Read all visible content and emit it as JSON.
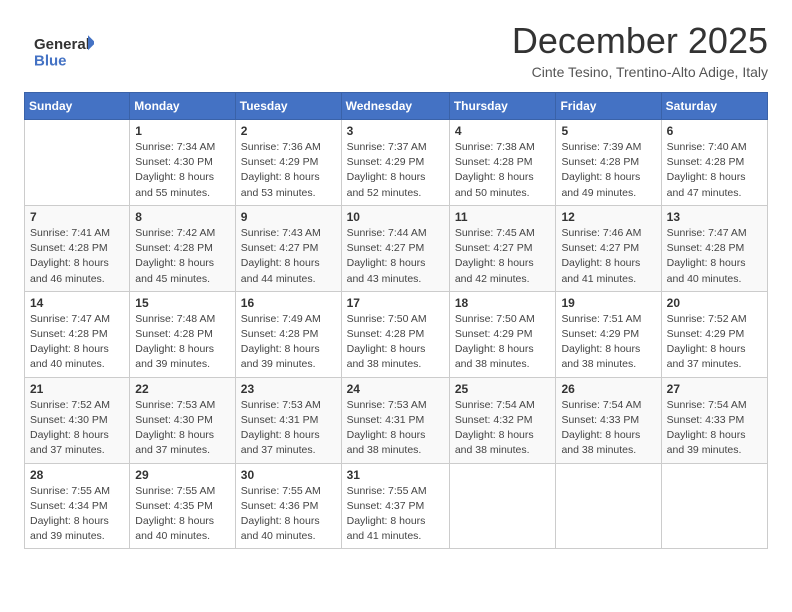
{
  "logo": {
    "line1": "General",
    "line2": "Blue"
  },
  "title": "December 2025",
  "subtitle": "Cinte Tesino, Trentino-Alto Adige, Italy",
  "weekdays": [
    "Sunday",
    "Monday",
    "Tuesday",
    "Wednesday",
    "Thursday",
    "Friday",
    "Saturday"
  ],
  "weeks": [
    [
      null,
      {
        "day": 1,
        "sunrise": "7:34 AM",
        "sunset": "4:30 PM",
        "daylight": "8 hours and 55 minutes."
      },
      {
        "day": 2,
        "sunrise": "7:36 AM",
        "sunset": "4:29 PM",
        "daylight": "8 hours and 53 minutes."
      },
      {
        "day": 3,
        "sunrise": "7:37 AM",
        "sunset": "4:29 PM",
        "daylight": "8 hours and 52 minutes."
      },
      {
        "day": 4,
        "sunrise": "7:38 AM",
        "sunset": "4:28 PM",
        "daylight": "8 hours and 50 minutes."
      },
      {
        "day": 5,
        "sunrise": "7:39 AM",
        "sunset": "4:28 PM",
        "daylight": "8 hours and 49 minutes."
      },
      {
        "day": 6,
        "sunrise": "7:40 AM",
        "sunset": "4:28 PM",
        "daylight": "8 hours and 47 minutes."
      }
    ],
    [
      {
        "day": 7,
        "sunrise": "7:41 AM",
        "sunset": "4:28 PM",
        "daylight": "8 hours and 46 minutes."
      },
      {
        "day": 8,
        "sunrise": "7:42 AM",
        "sunset": "4:28 PM",
        "daylight": "8 hours and 45 minutes."
      },
      {
        "day": 9,
        "sunrise": "7:43 AM",
        "sunset": "4:27 PM",
        "daylight": "8 hours and 44 minutes."
      },
      {
        "day": 10,
        "sunrise": "7:44 AM",
        "sunset": "4:27 PM",
        "daylight": "8 hours and 43 minutes."
      },
      {
        "day": 11,
        "sunrise": "7:45 AM",
        "sunset": "4:27 PM",
        "daylight": "8 hours and 42 minutes."
      },
      {
        "day": 12,
        "sunrise": "7:46 AM",
        "sunset": "4:27 PM",
        "daylight": "8 hours and 41 minutes."
      },
      {
        "day": 13,
        "sunrise": "7:47 AM",
        "sunset": "4:28 PM",
        "daylight": "8 hours and 40 minutes."
      }
    ],
    [
      {
        "day": 14,
        "sunrise": "7:47 AM",
        "sunset": "4:28 PM",
        "daylight": "8 hours and 40 minutes."
      },
      {
        "day": 15,
        "sunrise": "7:48 AM",
        "sunset": "4:28 PM",
        "daylight": "8 hours and 39 minutes."
      },
      {
        "day": 16,
        "sunrise": "7:49 AM",
        "sunset": "4:28 PM",
        "daylight": "8 hours and 39 minutes."
      },
      {
        "day": 17,
        "sunrise": "7:50 AM",
        "sunset": "4:28 PM",
        "daylight": "8 hours and 38 minutes."
      },
      {
        "day": 18,
        "sunrise": "7:50 AM",
        "sunset": "4:29 PM",
        "daylight": "8 hours and 38 minutes."
      },
      {
        "day": 19,
        "sunrise": "7:51 AM",
        "sunset": "4:29 PM",
        "daylight": "8 hours and 38 minutes."
      },
      {
        "day": 20,
        "sunrise": "7:52 AM",
        "sunset": "4:29 PM",
        "daylight": "8 hours and 37 minutes."
      }
    ],
    [
      {
        "day": 21,
        "sunrise": "7:52 AM",
        "sunset": "4:30 PM",
        "daylight": "8 hours and 37 minutes."
      },
      {
        "day": 22,
        "sunrise": "7:53 AM",
        "sunset": "4:30 PM",
        "daylight": "8 hours and 37 minutes."
      },
      {
        "day": 23,
        "sunrise": "7:53 AM",
        "sunset": "4:31 PM",
        "daylight": "8 hours and 37 minutes."
      },
      {
        "day": 24,
        "sunrise": "7:53 AM",
        "sunset": "4:31 PM",
        "daylight": "8 hours and 38 minutes."
      },
      {
        "day": 25,
        "sunrise": "7:54 AM",
        "sunset": "4:32 PM",
        "daylight": "8 hours and 38 minutes."
      },
      {
        "day": 26,
        "sunrise": "7:54 AM",
        "sunset": "4:33 PM",
        "daylight": "8 hours and 38 minutes."
      },
      {
        "day": 27,
        "sunrise": "7:54 AM",
        "sunset": "4:33 PM",
        "daylight": "8 hours and 39 minutes."
      }
    ],
    [
      {
        "day": 28,
        "sunrise": "7:55 AM",
        "sunset": "4:34 PM",
        "daylight": "8 hours and 39 minutes."
      },
      {
        "day": 29,
        "sunrise": "7:55 AM",
        "sunset": "4:35 PM",
        "daylight": "8 hours and 40 minutes."
      },
      {
        "day": 30,
        "sunrise": "7:55 AM",
        "sunset": "4:36 PM",
        "daylight": "8 hours and 40 minutes."
      },
      {
        "day": 31,
        "sunrise": "7:55 AM",
        "sunset": "4:37 PM",
        "daylight": "8 hours and 41 minutes."
      },
      null,
      null,
      null
    ]
  ]
}
